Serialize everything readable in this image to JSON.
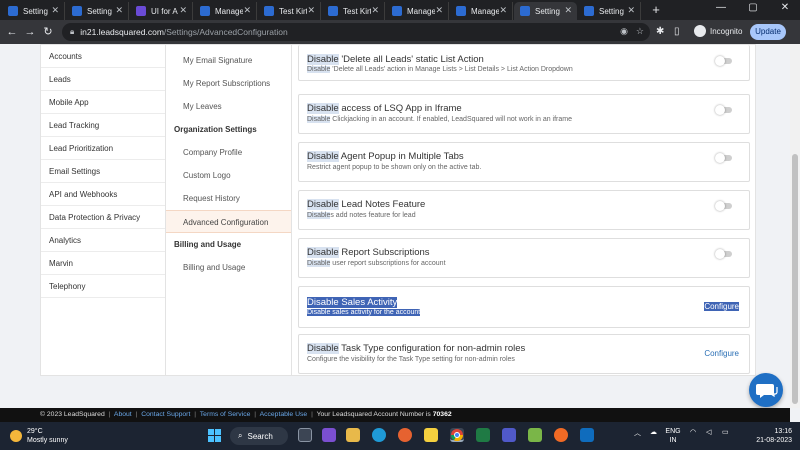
{
  "browser": {
    "tabs": [
      {
        "label": "Setting",
        "color": "#2c6bd1"
      },
      {
        "label": "Setting",
        "color": "#2c6bd1"
      },
      {
        "label": "UI for A",
        "color": "#6a4bd6"
      },
      {
        "label": "Manage",
        "color": "#2c6bd1"
      },
      {
        "label": "Test Kirt",
        "color": "#2c6bd1"
      },
      {
        "label": "Test Kirt",
        "color": "#2c6bd1"
      },
      {
        "label": "Manage",
        "color": "#2c6bd1"
      },
      {
        "label": "Manage",
        "color": "#2c6bd1"
      },
      {
        "label": "Setting",
        "color": "#2c6bd1",
        "active": true
      },
      {
        "label": "Setting",
        "color": "#2c6bd1"
      }
    ],
    "new_tab": "+",
    "window_controls": {
      "minimize": "—",
      "maximize": "▢",
      "close": "✕"
    },
    "url_domain": "in21.leadsquared.com",
    "url_path": "/Settings/AdvancedConfiguration",
    "incognito_label": "Incognito",
    "update_label": "Update"
  },
  "left_nav": {
    "items": [
      "Accounts",
      "Leads",
      "Mobile App",
      "Lead Tracking",
      "Lead Prioritization",
      "Email Settings",
      "API and Webhooks",
      "Data Protection & Privacy",
      "Analytics",
      "Marvin",
      "Telephony"
    ]
  },
  "sub_nav": {
    "items": [
      {
        "label": "My Email Signature",
        "type": "item"
      },
      {
        "label": "My Report Subscriptions",
        "type": "item"
      },
      {
        "label": "My Leaves",
        "type": "item"
      },
      {
        "label": "Organization Settings",
        "type": "head"
      },
      {
        "label": "Company Profile",
        "type": "item"
      },
      {
        "label": "Custom Logo",
        "type": "item"
      },
      {
        "label": "Request History",
        "type": "item"
      },
      {
        "label": "Advanced Configuration",
        "type": "item",
        "selected": true
      },
      {
        "label": "Billing and Usage",
        "type": "head"
      },
      {
        "label": "Billing and Usage",
        "type": "item"
      }
    ]
  },
  "settings": [
    {
      "title_hl": "Disable",
      "title_rest": " 'Delete all Leads' static List Action",
      "desc_hl": "Disable",
      "desc_rest": " 'Delete all Leads' action in Manage Lists > List Details > List Action Dropdown",
      "control": "toggle"
    },
    {
      "title_hl": "Disable",
      "title_rest": " access of LSQ App in Iframe",
      "desc_hl": "Disable",
      "desc_rest": " Clickjacking in an account. If enabled, LeadSquared will not work in an iframe",
      "control": "toggle"
    },
    {
      "title_hl": "Disable",
      "title_rest": " Agent Popup in Multiple Tabs",
      "desc_hl": "",
      "desc_rest": "Restrict agent popup to be shown only on the active tab.",
      "control": "toggle"
    },
    {
      "title_hl": "Disable",
      "title_rest": " Lead Notes Feature",
      "desc_hl": "Disable",
      "desc_rest": "s add notes feature for lead",
      "control": "toggle"
    },
    {
      "title_hl": "Disable",
      "title_rest": " Report Subscriptions",
      "desc_hl": "Disable",
      "desc_rest": " user report subscriptions for account",
      "control": "toggle"
    },
    {
      "title_hl": "",
      "title_rest": "Disable Sales Activity",
      "desc_hl": "",
      "desc_rest": "Disable sales activity for the account",
      "control": "configure",
      "selected": true
    },
    {
      "title_hl": "Disable",
      "title_rest": " Task Type configuration for non-admin roles",
      "desc_hl": "",
      "desc_rest": "Configure the visibility for the Task Type setting for non-admin roles",
      "control": "configure"
    }
  ],
  "configure_label": "Configure",
  "footer": {
    "copyright": "© 2023 LeadSquared",
    "links": [
      "About",
      "Contact Support",
      "Terms of Service",
      "Acceptable Use"
    ],
    "account_text": "Your Leadsquared Account Number is",
    "account_number": "70362"
  },
  "taskbar": {
    "temperature": "29°C",
    "weather": "Mostly sunny",
    "search_label": "Search",
    "lang_top": "ENG",
    "lang_bottom": "IN",
    "time": "13:16",
    "date": "21-08-2023"
  }
}
